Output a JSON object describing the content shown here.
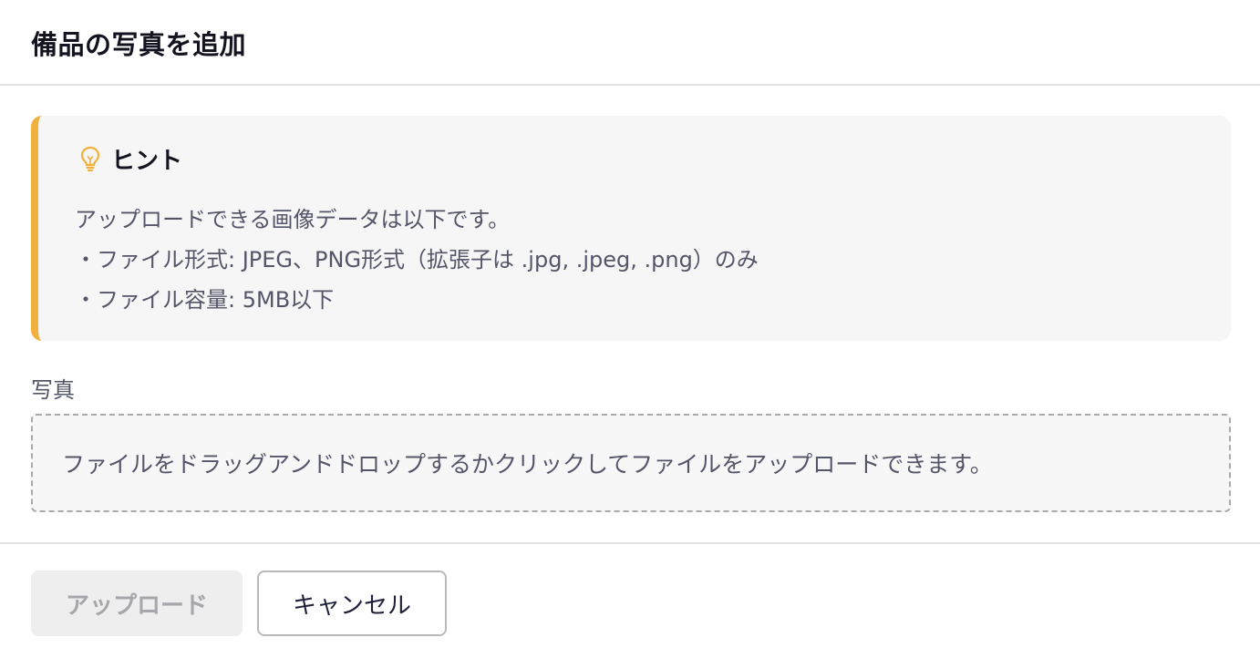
{
  "dialog": {
    "title": "備品の写真を追加"
  },
  "hint": {
    "icon": "lightbulb-icon",
    "accent_color": "#f2b13c",
    "title": "ヒント",
    "lines": [
      "アップロードできる画像データは以下です。",
      "・ファイル形式: JPEG、PNG形式（拡張子は .jpg, .jpeg, .png）のみ",
      "・ファイル容量: 5MB以下"
    ]
  },
  "photo_field": {
    "label": "写真",
    "dropzone_text": "ファイルをドラッグアンドドロップするかクリックしてファイルをアップロードできます。"
  },
  "footer": {
    "upload_label": "アップロード",
    "upload_disabled": true,
    "cancel_label": "キャンセル"
  }
}
